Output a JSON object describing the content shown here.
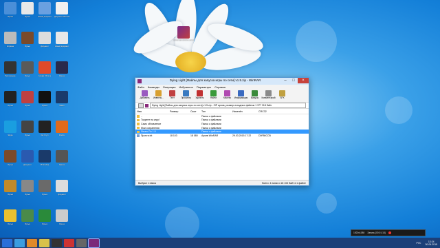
{
  "desktop": {
    "icons": [
      {
        "label": "Ярлык"
      },
      {
        "label": "Ярлык"
      },
      {
        "label": "Новый документ"
      },
      {
        "label": "Документ Microsoft Word"
      },
      {
        "label": "Корзина"
      },
      {
        "label": "Ярлык"
      },
      {
        "label": "Документ"
      },
      {
        "label": "Новый документ"
      },
      {
        "label": "Приложение"
      },
      {
        "label": "Ярлык"
      },
      {
        "label": "Google Chrome"
      },
      {
        "label": "Ярлык"
      },
      {
        "label": "Ярлык"
      },
      {
        "label": "Ярлык"
      },
      {
        "label": "Ярлык"
      },
      {
        "label": "Steam"
      },
      {
        "label": "Skype"
      },
      {
        "label": "Ярлык"
      },
      {
        "label": "Far Cry 4"
      },
      {
        "label": "Firefox"
      },
      {
        "label": "Ярлык"
      },
      {
        "label": "Документ"
      },
      {
        "label": "Photoshop"
      },
      {
        "label": "Ярлык"
      },
      {
        "label": "Ярлык"
      },
      {
        "label": "Ярлык"
      },
      {
        "label": "Ярлык"
      },
      {
        "label": "Документ"
      },
      {
        "label": "Ярлык"
      },
      {
        "label": "Ярлык"
      },
      {
        "label": "Ярлык"
      },
      {
        "label": "Ярлык"
      }
    ],
    "winrar_icon_label": "Dying Light [Файлы для запуска игры по сети]"
  },
  "window": {
    "title": "Dying Light [Файлы для запуска игры по сети] v1.5.zip - WinRAR",
    "menu": [
      "Файл",
      "Команды",
      "Операции",
      "Избранное",
      "Параметры",
      "Справка"
    ],
    "toolbar": [
      "Добавить",
      "Извлечь...",
      "Тест",
      "Просмотр",
      "Удалить",
      "Найти",
      "Мастер",
      "Информация",
      "Вирусы",
      "Комментарий",
      "SFX"
    ],
    "path": "Dying Light [Файлы для запуска игры по сети] v1.5.zip - ZIP архив, размер исходных файлов 1 377 318 байт",
    "columns": [
      "Имя",
      "Размер",
      "Сжат",
      "Тип",
      "Изменён",
      "CRC32"
    ],
    "files": [
      {
        "name": "..",
        "size": "",
        "packed": "",
        "type": "Папка с файлами",
        "modified": "",
        "crc": ""
      },
      {
        "name": "Торрент на игру!",
        "size": "",
        "packed": "",
        "type": "Папка с файлами",
        "modified": "",
        "crc": ""
      },
      {
        "name": "Само обновление",
        "size": "",
        "packed": "",
        "type": "Папка с файлами",
        "modified": "",
        "crc": ""
      },
      {
        "name": "Мои сохранения",
        "size": "",
        "packed": "",
        "type": "Папка с файлами",
        "modified": "",
        "crc": ""
      },
      {
        "name": "Steam Fix 1.5",
        "size": "",
        "packed": "",
        "type": "Папка с файлами",
        "modified": "",
        "crc": ""
      },
      {
        "name": "Прочти.txt",
        "size": "18 103",
        "packed": "18 080",
        "type": "Архив WinRAR",
        "modified": "29.03.2015 17:22",
        "crc": "D0F80CCB"
      }
    ],
    "status_left": "Выбран 1 папка",
    "status_right": "Всего: 4 папки и 18 103 байт в 1 файле"
  },
  "recorder": {
    "resolution": "1920x1080",
    "label": "Запись [00:01:15]"
  },
  "tray": {
    "lang": "РУС",
    "time": "13:24",
    "date": "30.04.2015"
  }
}
